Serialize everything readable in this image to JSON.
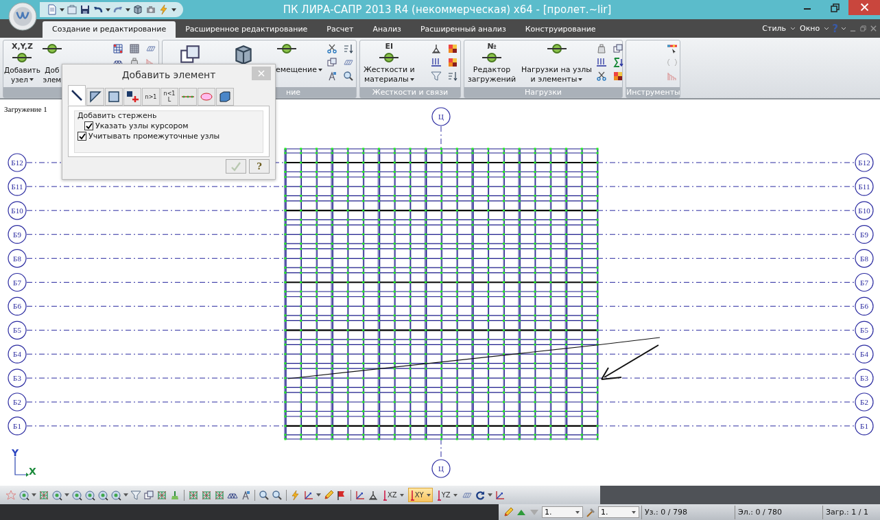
{
  "window": {
    "title": "ПК ЛИРА-САПР  2013 R4 (некоммерческая) x64 - [пролет.~lir]"
  },
  "ribbon_tabs": [
    {
      "label": "Создание и редактирование",
      "selected": true
    },
    {
      "label": "Расширенное редактирование",
      "selected": false
    },
    {
      "label": "Расчет",
      "selected": false
    },
    {
      "label": "Анализ",
      "selected": false
    },
    {
      "label": "Расширенный анализ",
      "selected": false
    },
    {
      "label": "Конструирование",
      "selected": false
    }
  ],
  "menu_right": [
    {
      "label": "Стиль"
    },
    {
      "label": "Окно"
    }
  ],
  "help": "?",
  "ribbon_groups": [
    {
      "buttons": [
        {
          "lines": [
            "Добавить",
            "узел"
          ],
          "dropdown": true,
          "icon_label": "X,Y,Z"
        },
        {
          "lines": [
            "Доб",
            "элем"
          ],
          "dropdown": false
        }
      ]
    },
    {
      "label": "ние",
      "buttons": [
        {
          "lines": [
            "емещение"
          ],
          "dropdown": true
        }
      ]
    },
    {
      "label": "Жесткости и связи",
      "buttons": [
        {
          "lines": [
            "Жесткости и",
            "материалы"
          ],
          "dropdown": true,
          "icon_label": "EI"
        }
      ]
    },
    {
      "label": "Нагрузки",
      "buttons": [
        {
          "lines": [
            "Редактор",
            "загружений"
          ],
          "dropdown": false,
          "icon_label": "№"
        },
        {
          "lines": [
            "Нагрузки на узлы",
            "и элементы"
          ],
          "dropdown": true
        }
      ]
    },
    {
      "label": "Инструменты"
    }
  ],
  "dialog": {
    "title": "Добавить элемент",
    "tabs": [
      {
        "selected": true
      },
      {
        "selected": false
      },
      {
        "selected": false
      },
      {
        "selected": false
      },
      {
        "selected": false,
        "label": "n>1"
      },
      {
        "selected": false,
        "label": "n<1",
        "sublabel": "L"
      },
      {
        "selected": false
      },
      {
        "selected": false
      },
      {
        "selected": false
      }
    ],
    "group_label": "Добавить стержень",
    "options": [
      {
        "label": "Указать узлы курсором",
        "checked": true
      },
      {
        "label": "Учитывать промежуточные узлы",
        "checked": true
      }
    ],
    "ok_button": {
      "disabled": true
    },
    "help_button": "?"
  },
  "canvas": {
    "load_case": "Загружение 1",
    "horizontal_axes": [
      {
        "left": "Б12",
        "right": "Б12"
      },
      {
        "left": "Б11",
        "right": "Б11"
      },
      {
        "left": "Б10",
        "right": "Б10"
      },
      {
        "left": "Б9",
        "right": "Б9"
      },
      {
        "left": "Б8",
        "right": "Б8"
      },
      {
        "left": "Б7",
        "right": "Б7"
      },
      {
        "left": "Б6",
        "right": "Б6"
      },
      {
        "left": "Б5",
        "right": "Б5"
      },
      {
        "left": "Б4",
        "right": "Б4"
      },
      {
        "left": "Б3",
        "right": "Б3"
      },
      {
        "left": "Б2",
        "right": "Б2"
      },
      {
        "left": "Б1",
        "right": "Б1"
      }
    ],
    "vertical_axis": {
      "top": "Ц",
      "bottom": "Ц"
    },
    "axis_y": "Y",
    "axis_x": "X"
  },
  "view_buttons": [
    {
      "label": "XZ",
      "selected": false
    },
    {
      "label": "XY",
      "selected": true
    },
    {
      "label": "YZ",
      "selected": false
    }
  ],
  "status_bar": {
    "case_field": "1.",
    "material_field": "1.",
    "nodes": "Уз.: 0 / 798",
    "elements": "Эл.: 0 / 780",
    "loads": "Загр.: 1 / 1"
  }
}
